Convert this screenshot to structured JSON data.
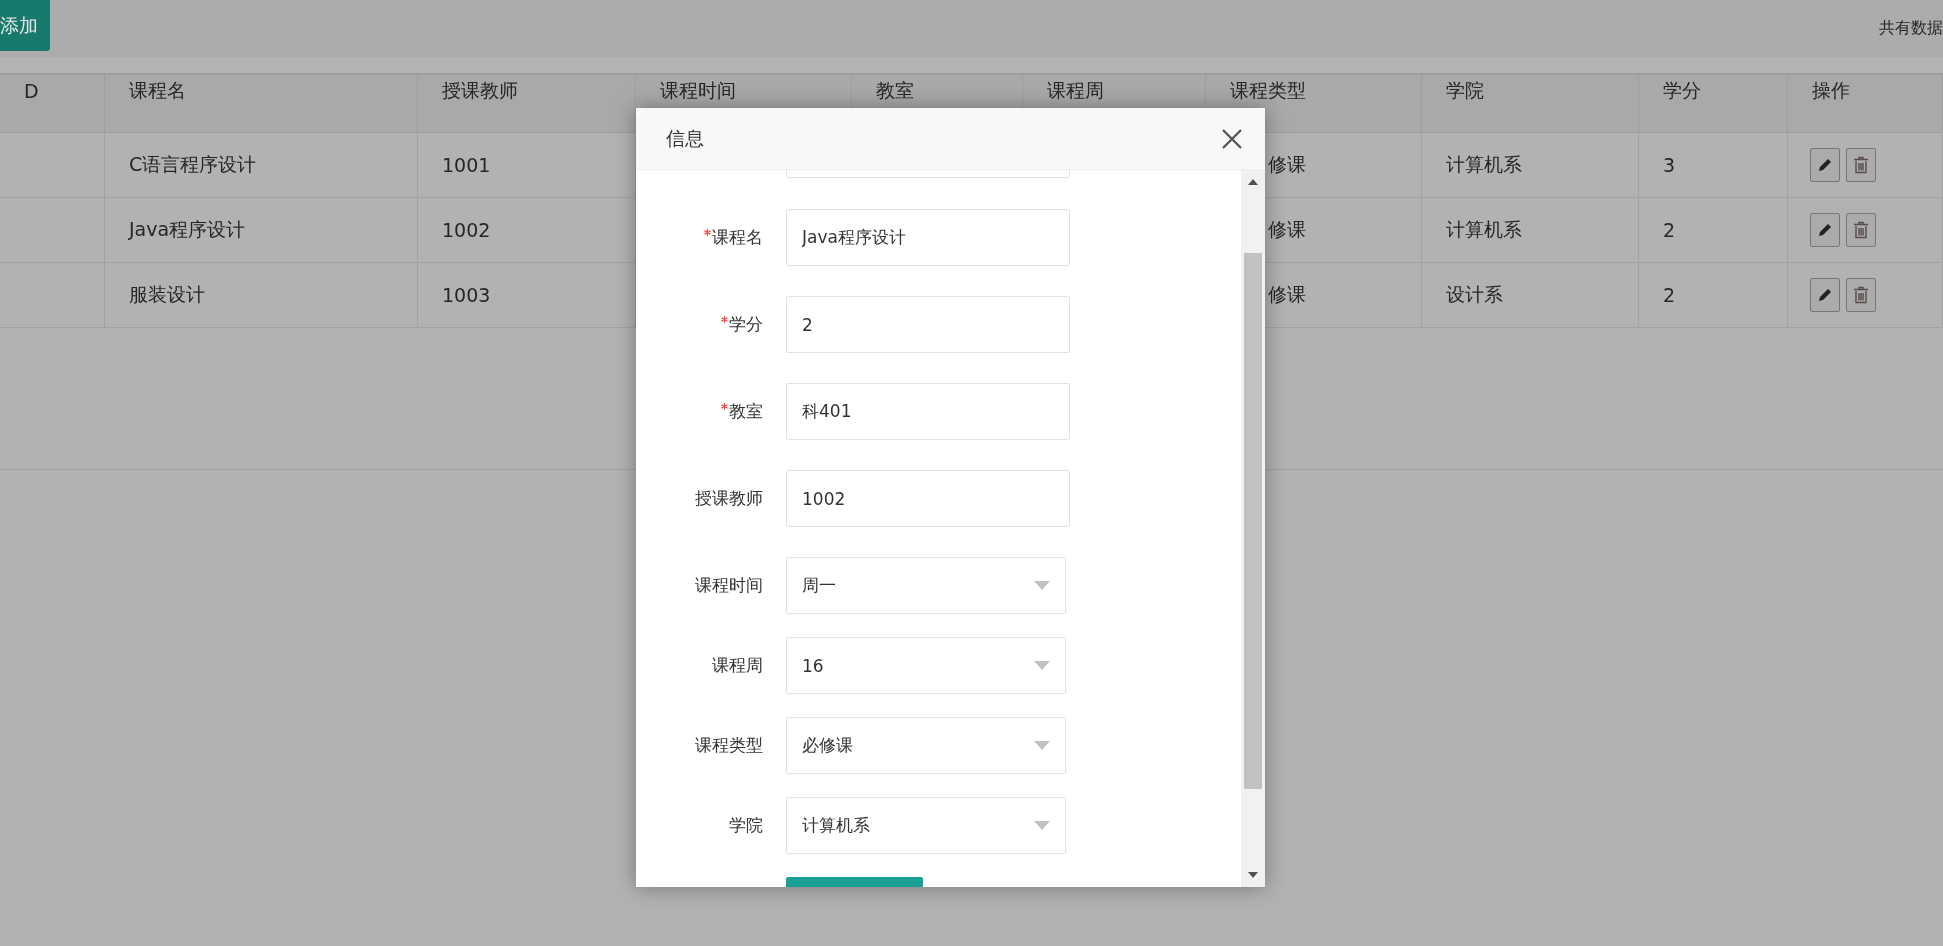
{
  "toolbar": {
    "add_button": "添加",
    "total_text": "共有数据"
  },
  "table": {
    "columns": [
      "D",
      "课程名",
      "授课教师",
      "课程时间",
      "教室",
      "课程周",
      "课程类型",
      "学院",
      "学分",
      "操作"
    ],
    "rows": [
      {
        "name": "C语言程序设计",
        "teacher": "1001",
        "type": "修课",
        "college": "计算机系",
        "credits": "3"
      },
      {
        "name": "Java程序设计",
        "teacher": "1002",
        "type": "修课",
        "college": "计算机系",
        "credits": "2"
      },
      {
        "name": "服装设计",
        "teacher": "1003",
        "type": "修课",
        "college": "设计系",
        "credits": "2"
      }
    ]
  },
  "dialog": {
    "title": "信息",
    "fields": [
      {
        "label": "课程名",
        "required": true,
        "kind": "input",
        "value": "Java程序设计"
      },
      {
        "label": "学分",
        "required": true,
        "kind": "input",
        "value": "2"
      },
      {
        "label": "教室",
        "required": true,
        "kind": "input",
        "value": "科401"
      },
      {
        "label": "授课教师",
        "required": false,
        "kind": "input",
        "value": "1002"
      },
      {
        "label": "课程时间",
        "required": false,
        "kind": "select",
        "value": "周一"
      },
      {
        "label": "课程周",
        "required": false,
        "kind": "select",
        "value": "16"
      },
      {
        "label": "课程类型",
        "required": false,
        "kind": "select",
        "value": "必修课"
      },
      {
        "label": "学院",
        "required": false,
        "kind": "select",
        "value": "计算机系"
      }
    ]
  }
}
